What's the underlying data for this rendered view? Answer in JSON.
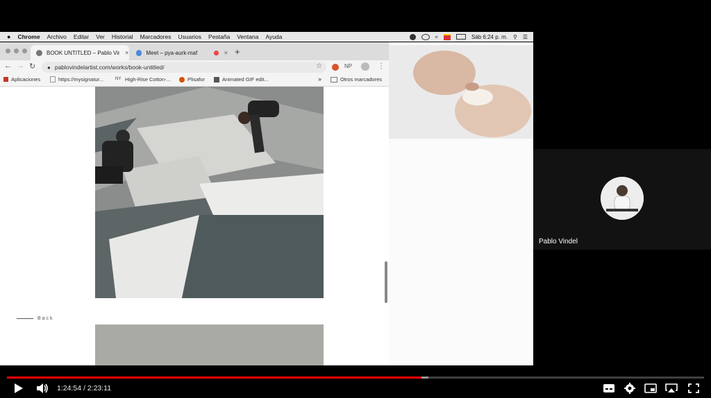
{
  "menubar": {
    "items": [
      "Chrome",
      "Archivo",
      "Editar",
      "Ver",
      "Historial",
      "Marcadores",
      "Usuarios",
      "Pestaña",
      "Ventana",
      "Ayuda"
    ],
    "clock": "Sáb 6:24 p. m."
  },
  "browser": {
    "tabs": [
      {
        "label": "BOOK UNTITLED – Pablo Vindel",
        "close": "×"
      },
      {
        "label": "Meet – pya-aurk-maf",
        "close": "×"
      }
    ],
    "new_tab": "+",
    "url": "pablovindelartist.com/works/book-untitled/",
    "bookmarks": [
      "Aplicaciones",
      "https://mysignatur...",
      "High-Rise Cotton-...",
      "Plisafor",
      "Animated GIF edit..."
    ],
    "bookmarks_more": "»",
    "other_bookmarks": "Otros marcadores",
    "profile_initials": "NP"
  },
  "page": {
    "back_label": "Back"
  },
  "meet": {
    "participant_name": "Pablo Vindel"
  },
  "player": {
    "current_time": "1:24:54",
    "duration": "2:23:11",
    "progress_fraction": 0.595,
    "buffered_fraction": 0.605,
    "accent": "#ff0000"
  }
}
